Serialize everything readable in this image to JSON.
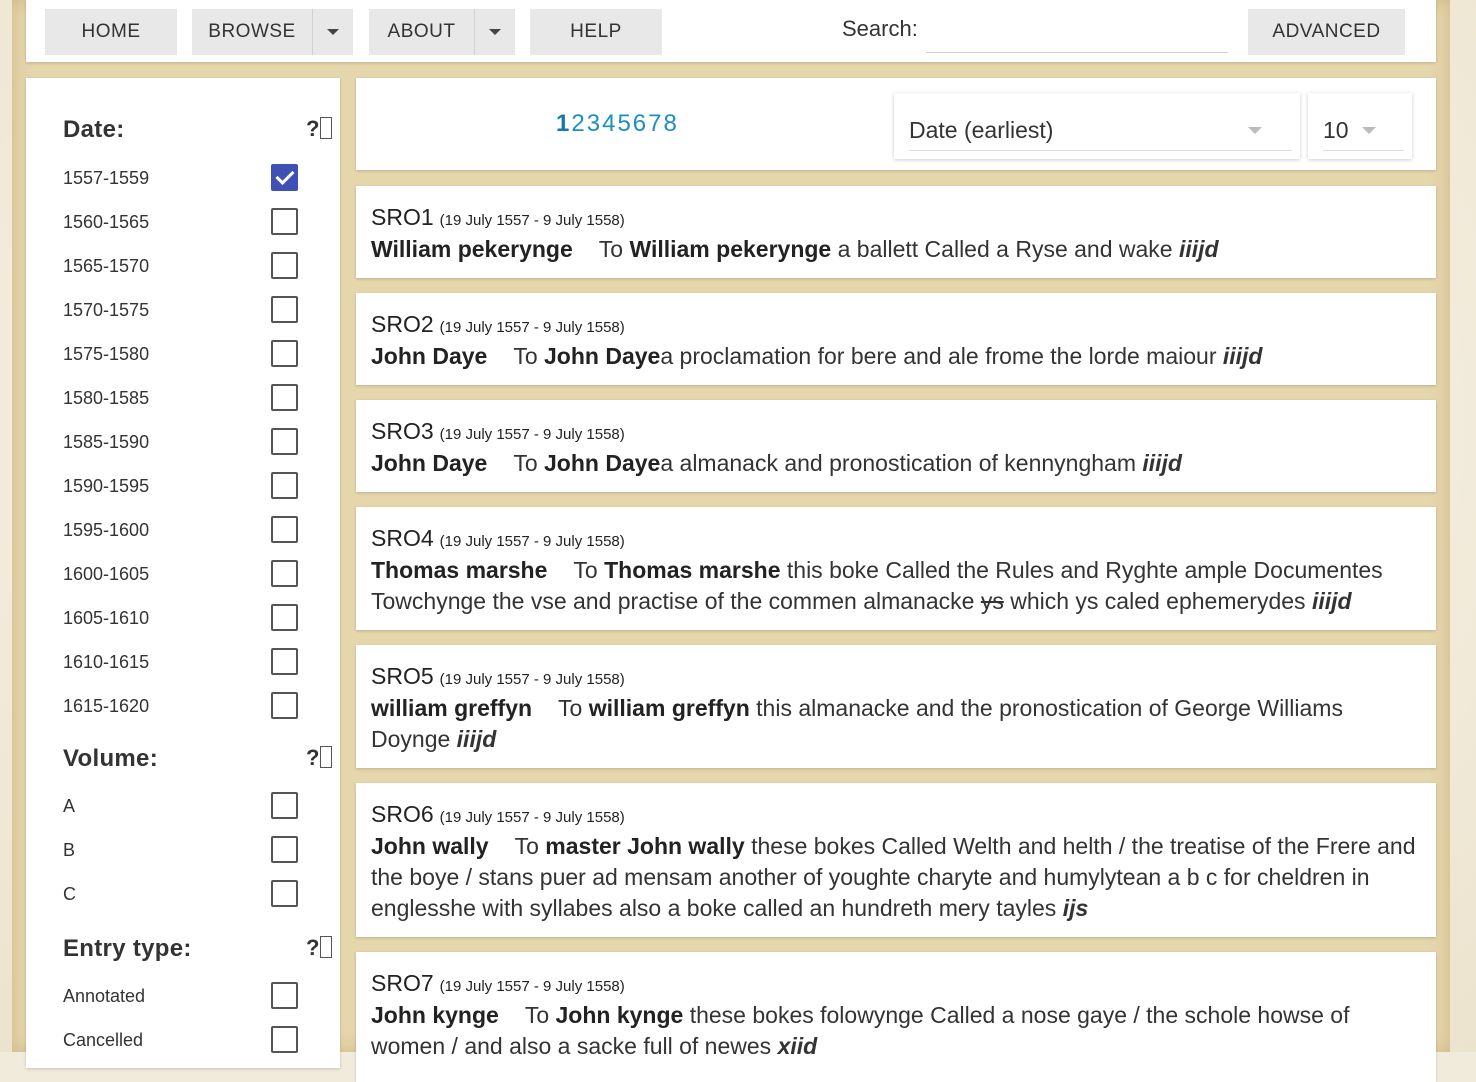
{
  "nav": {
    "home": "HOME",
    "browse": "BROWSE",
    "about": "ABOUT",
    "help": "HELP",
    "search_label": "Search:",
    "search_value": "",
    "advanced": "ADVANCED"
  },
  "sidebar": {
    "help_glyph": "?",
    "date": {
      "title": "Date:",
      "options": [
        {
          "label": "1557-1559",
          "checked": true
        },
        {
          "label": "1560-1565",
          "checked": false
        },
        {
          "label": "1565-1570",
          "checked": false
        },
        {
          "label": "1570-1575",
          "checked": false
        },
        {
          "label": "1575-1580",
          "checked": false
        },
        {
          "label": "1580-1585",
          "checked": false
        },
        {
          "label": "1585-1590",
          "checked": false
        },
        {
          "label": "1590-1595",
          "checked": false
        },
        {
          "label": "1595-1600",
          "checked": false
        },
        {
          "label": "1600-1605",
          "checked": false
        },
        {
          "label": "1605-1610",
          "checked": false
        },
        {
          "label": "1610-1615",
          "checked": false
        },
        {
          "label": "1615-1620",
          "checked": false
        }
      ]
    },
    "volume": {
      "title": "Volume:",
      "options": [
        {
          "label": "A",
          "checked": false
        },
        {
          "label": "B",
          "checked": false
        },
        {
          "label": "C",
          "checked": false
        }
      ]
    },
    "entry_type": {
      "title": "Entry type:",
      "options": [
        {
          "label": "Annotated",
          "checked": false
        },
        {
          "label": "Cancelled",
          "checked": false
        }
      ]
    }
  },
  "results": {
    "pages": [
      "1",
      "2",
      "3",
      "4",
      "5",
      "6",
      "7",
      "8"
    ],
    "current_page": "1",
    "sort": "Date (earliest)",
    "per_page": "10",
    "entries": [
      {
        "id": "SRO1",
        "date": "(19 July 1557 - 9 July 1558)",
        "name": "William pekerynge",
        "parts": [
          {
            "t": "To "
          },
          {
            "b": "William pekerynge"
          },
          {
            "t": " a ballett Called a Ryse and wake "
          },
          {
            "fee": "iiijd"
          }
        ]
      },
      {
        "id": "SRO2",
        "date": "(19 July 1557 - 9 July 1558)",
        "name": "John Daye",
        "parts": [
          {
            "t": "To "
          },
          {
            "b": "John Daye"
          },
          {
            "t": "a proclamation for bere and ale frome the lorde maiour "
          },
          {
            "fee": "iiijd"
          }
        ]
      },
      {
        "id": "SRO3",
        "date": "(19 July 1557 - 9 July 1558)",
        "name": "John Daye",
        "parts": [
          {
            "t": "To "
          },
          {
            "b": "John Daye"
          },
          {
            "t": "a almanack and pronostication of kennyngham  "
          },
          {
            "fee": "iiijd"
          }
        ]
      },
      {
        "id": "SRO4",
        "date": "(19 July 1557 - 9 July 1558)",
        "name": "Thomas marshe",
        "parts": [
          {
            "t": "To "
          },
          {
            "b": "Thomas marshe"
          },
          {
            "t": " this boke Called the Rules and Ryghte ample Documentes Towchynge the vse and practise of the commen almanacke "
          },
          {
            "s": "ys"
          },
          {
            "t": " which ys caled ephemerydes "
          },
          {
            "fee": "iiijd"
          }
        ]
      },
      {
        "id": "SRO5",
        "date": "(19 July 1557 - 9 July 1558)",
        "name": "william greffyn",
        "parts": [
          {
            "t": "To "
          },
          {
            "b": "william greffyn"
          },
          {
            "t": " this almanacke and the pronostication of George Williams Doynge "
          },
          {
            "fee": "iiijd"
          }
        ]
      },
      {
        "id": "SRO6",
        "date": "(19 July 1557 - 9 July 1558)",
        "name": "John wally",
        "parts": [
          {
            "t": "To "
          },
          {
            "b": "master John wally"
          },
          {
            "t": " these bokes Called Welth and helth / the treatise of the Frere and the boye / stans puer ad mensam another of youghte charyte and humylytean a b c for cheldren in englesshe with syllabes also a boke called an hundreth mery tayles "
          },
          {
            "fee": "ijs"
          }
        ]
      },
      {
        "id": "SRO7",
        "date": "(19 July 1557 - 9 July 1558)",
        "name": "John kynge",
        "parts": [
          {
            "t": "To "
          },
          {
            "b": "John kynge"
          },
          {
            "t": " these bokes folowynge Called a nose gaye / the schole howse of women / and also a sacke full of newes "
          },
          {
            "fee": "xiid"
          }
        ]
      }
    ]
  }
}
